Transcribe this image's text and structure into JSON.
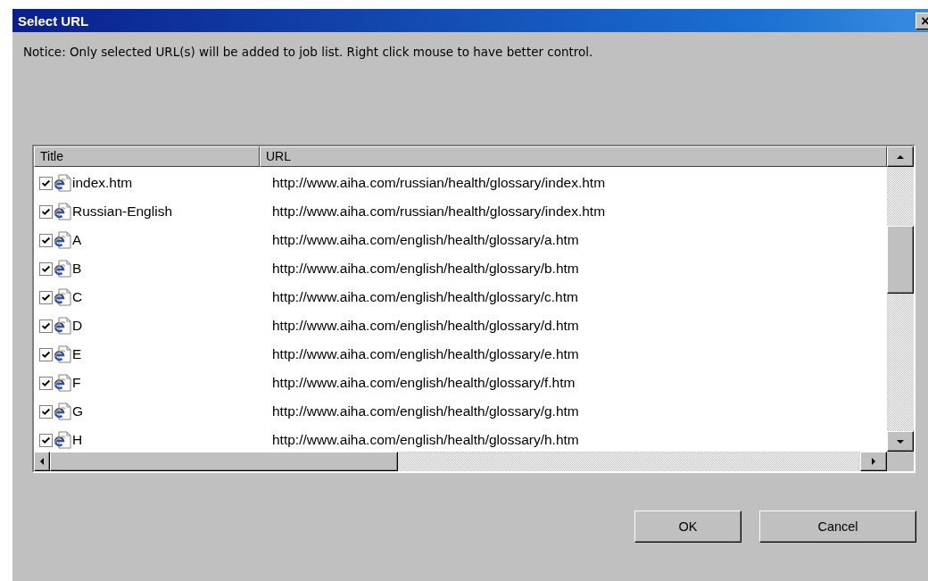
{
  "window": {
    "title": "Select URL",
    "close": "×"
  },
  "notice": "Notice: Only selected URL(s) will be added to job list. Right click mouse to have better control.",
  "table": {
    "columns": [
      "Title",
      "URL"
    ],
    "rows": [
      {
        "title": "index.htm",
        "url": "http://www.aiha.com/russian/health/glossary/index.htm",
        "checked": true
      },
      {
        "title": "Russian-English",
        "url": "http://www.aiha.com/russian/health/glossary/index.htm",
        "checked": true
      },
      {
        "title": "A",
        "url": "http://www.aiha.com/english/health/glossary/a.htm",
        "checked": true
      },
      {
        "title": "B",
        "url": "http://www.aiha.com/english/health/glossary/b.htm",
        "checked": true
      },
      {
        "title": "C",
        "url": "http://www.aiha.com/english/health/glossary/c.htm",
        "checked": true
      },
      {
        "title": "D",
        "url": "http://www.aiha.com/english/health/glossary/d.htm",
        "checked": true
      },
      {
        "title": "E",
        "url": "http://www.aiha.com/english/health/glossary/e.htm",
        "checked": true
      },
      {
        "title": "F",
        "url": "http://www.aiha.com/english/health/glossary/f.htm",
        "checked": true
      },
      {
        "title": "G",
        "url": "http://www.aiha.com/english/health/glossary/g.htm",
        "checked": true
      },
      {
        "title": "H",
        "url": "http://www.aiha.com/english/health/glossary/h.htm",
        "checked": true
      }
    ]
  },
  "buttons": [
    "OK",
    "Cancel"
  ]
}
